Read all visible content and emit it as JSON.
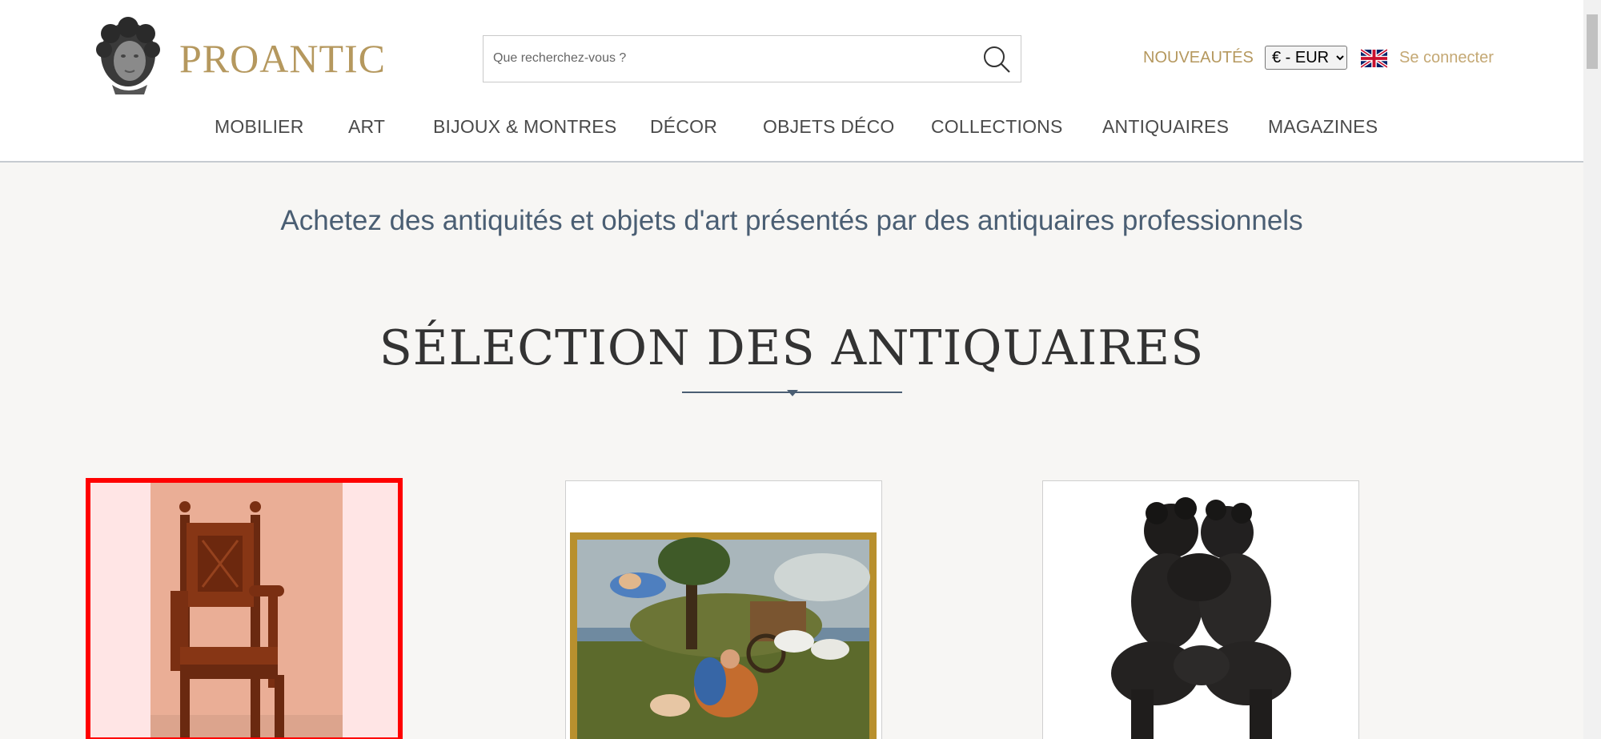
{
  "header": {
    "brand": "PROANTIC",
    "search": {
      "placeholder": "Que recherchez-vous ?",
      "value": ""
    },
    "new_label": "NOUVEAUTÉS",
    "currency": {
      "selected": "€ - EUR"
    },
    "language_icon": "uk-flag-icon",
    "login_label": "Se connecter"
  },
  "nav": {
    "items": [
      {
        "label": "MOBILIER"
      },
      {
        "label": "ART"
      },
      {
        "label": "BIJOUX & MONTRES"
      },
      {
        "label": "DÉCOR"
      },
      {
        "label": "OBJETS DÉCO"
      },
      {
        "label": "COLLECTIONS"
      },
      {
        "label": "ANTIQUAIRES"
      },
      {
        "label": "MAGAZINES"
      }
    ]
  },
  "main": {
    "tagline": "Achetez des antiquités et objets d'art présentés par des antiquaires professionnels",
    "section_title": "SÉLECTION DES ANTIQUAIRES",
    "products": [
      {
        "image": "carved-wooden-armchair",
        "selected": true
      },
      {
        "image": "framed-oil-painting",
        "selected": false
      },
      {
        "image": "bronze-putti-sculpture",
        "selected": false
      }
    ]
  },
  "colors": {
    "brand_gold": "#b5985e",
    "text_blue": "#4a5e73",
    "selection_red": "#ff0000",
    "page_bg": "#f7f6f4"
  }
}
